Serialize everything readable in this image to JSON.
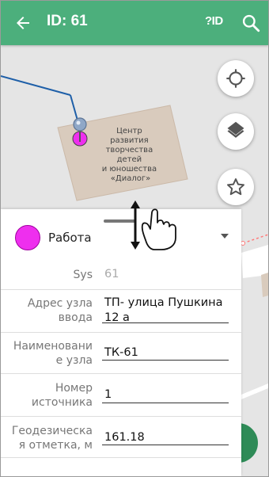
{
  "appbar": {
    "title": "ID: 61",
    "pid_label": "?ID",
    "back_icon": "arrow-left-icon",
    "search_icon": "search-icon",
    "color": "#4caf7c"
  },
  "map": {
    "building_label": "Центр\nразвития\nтворчества\nдетей\nи юношества\n«Диалог»",
    "buttons": [
      "my-location-icon",
      "layers-icon",
      "star-outline-icon"
    ],
    "line_color": "#1e5fa8",
    "marker_color": "#ee2fee"
  },
  "sheet": {
    "status": "Работа",
    "status_color": "#ee2fee",
    "fields": [
      {
        "label": "Sys",
        "value": "61"
      },
      {
        "label": "Адрес узла ввода",
        "value": "ТП- улица Пушкина 12 а"
      },
      {
        "label": "Наименование узла",
        "value": "ТК-61"
      },
      {
        "label": "Номер источника",
        "value": "1"
      },
      {
        "label": "Геодезическая отметка, м",
        "value": "161.18"
      }
    ]
  }
}
